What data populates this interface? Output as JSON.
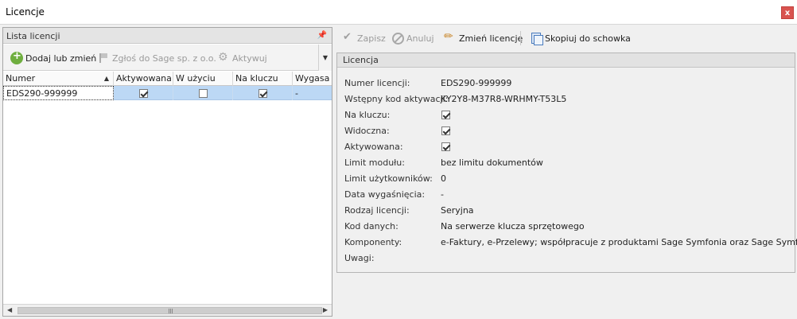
{
  "window": {
    "title": "Licencje",
    "close_label": "x"
  },
  "left_panel": {
    "title": "Lista licencji",
    "pin": "📌",
    "toolbar": {
      "add_label": "Dodaj lub zmień",
      "report_label": "Zgłoś do Sage sp. z o.o.",
      "activate_label": "Aktywuj",
      "dropdown": "▼"
    },
    "grid": {
      "columns": [
        "Numer",
        "Aktywowana",
        "W użyciu",
        "Na kluczu",
        "Wygasa"
      ],
      "sort_indicator": "▲",
      "rows": [
        {
          "numer": "EDS290-999999",
          "aktywowana": true,
          "w_uzyciu": false,
          "na_kluczu": true,
          "wygasa": "-"
        }
      ]
    },
    "scroll": {
      "left": "◀",
      "right": "▶"
    }
  },
  "right_toolbar": {
    "save_label": "Zapisz",
    "cancel_label": "Anuluj",
    "change_label": "Zmień licencję",
    "copy_label": "Skopiuj do schowka"
  },
  "details": {
    "group_title": "Licencja",
    "fields": {
      "numer_label": "Numer licencji:",
      "numer_value": "EDS290-999999",
      "kod_label": "Wstępny kod aktywacji:",
      "kod_value": "KY2Y8-M37R8-WRHMY-T53L5",
      "na_kluczu_label": "Na kluczu:",
      "na_kluczu": true,
      "widoczna_label": "Widoczna:",
      "widoczna": true,
      "aktywowana_label": "Aktywowana:",
      "aktywowana": true,
      "limit_modulu_label": "Limit modułu:",
      "limit_modulu_value": "bez limitu dokumentów",
      "limit_uzytk_label": "Limit użytkowników:",
      "limit_uzytk_value": "0",
      "data_wyg_label": "Data wygaśnięcia:",
      "data_wyg_value": "-",
      "rodzaj_label": "Rodzaj licencji:",
      "rodzaj_value": "Seryjna",
      "kod_danych_label": "Kod danych:",
      "kod_danych_value": "Na serwerze klucza sprzętowego",
      "komponenty_label": "Komponenty:",
      "komponenty_value": "e-Faktury, e-Przelewy; współpracuje z produktami Sage Symfonia oraz Sage Symfonia ...",
      "uwagi_label": "Uwagi:"
    }
  }
}
